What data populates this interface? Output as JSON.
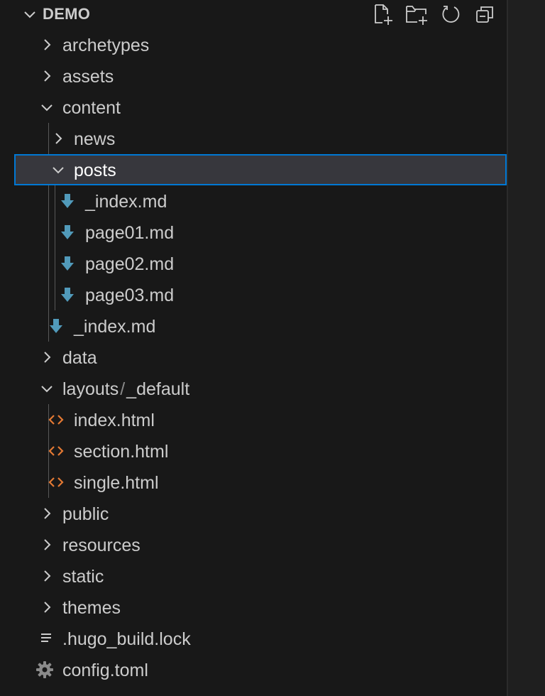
{
  "explorer": {
    "title": "DEMO",
    "actions": [
      {
        "name": "new-file-icon"
      },
      {
        "name": "new-folder-icon"
      },
      {
        "name": "refresh-icon"
      },
      {
        "name": "collapse-all-icon"
      }
    ],
    "items": [
      {
        "label": "archetypes",
        "type": "folder",
        "expanded": false
      },
      {
        "label": "assets",
        "type": "folder",
        "expanded": false
      },
      {
        "label": "content",
        "type": "folder",
        "expanded": true
      },
      {
        "label": "news",
        "type": "folder",
        "expanded": false
      },
      {
        "label": "posts",
        "type": "folder",
        "expanded": true,
        "selected": true
      },
      {
        "label": "_index.md",
        "type": "markdown"
      },
      {
        "label": "page01.md",
        "type": "markdown"
      },
      {
        "label": "page02.md",
        "type": "markdown"
      },
      {
        "label": "page03.md",
        "type": "markdown"
      },
      {
        "label": "_index.md",
        "type": "markdown"
      },
      {
        "label": "data",
        "type": "folder",
        "expanded": false
      },
      {
        "label_a": "layouts",
        "label_sep": "/",
        "label_b": "_default",
        "type": "folder",
        "expanded": true
      },
      {
        "label": "index.html",
        "type": "html"
      },
      {
        "label": "section.html",
        "type": "html"
      },
      {
        "label": "single.html",
        "type": "html"
      },
      {
        "label": "public",
        "type": "folder",
        "expanded": false
      },
      {
        "label": "resources",
        "type": "folder",
        "expanded": false
      },
      {
        "label": "static",
        "type": "folder",
        "expanded": false
      },
      {
        "label": "themes",
        "type": "folder",
        "expanded": false
      },
      {
        "label": ".hugo_build.lock",
        "type": "text"
      },
      {
        "label": "config.toml",
        "type": "settings"
      }
    ]
  },
  "colors": {
    "background": "#181818",
    "selection_border": "#0078d4",
    "markdown_icon": "#519aba",
    "html_icon": "#e37933",
    "text": "#cccccc"
  }
}
